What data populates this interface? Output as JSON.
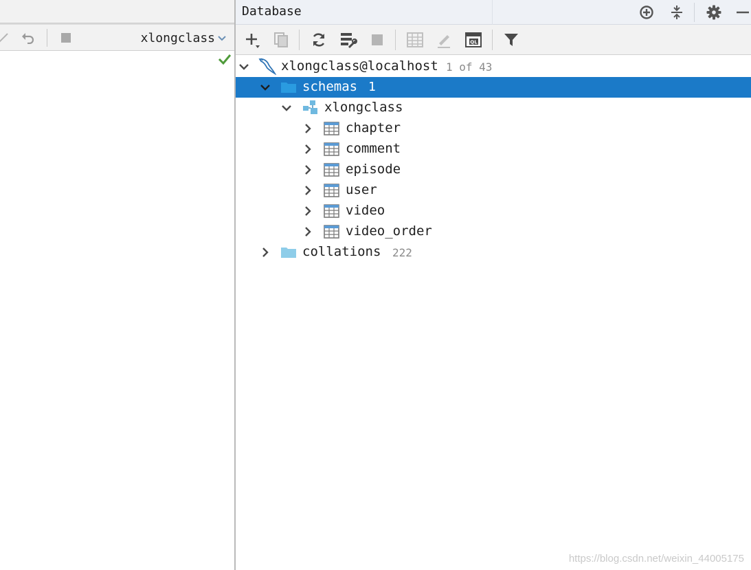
{
  "editor": {
    "schema_selector": "xlongclass",
    "status_icon": "check-icon"
  },
  "panel": {
    "title": "Database",
    "header_icons": [
      "crosshair-icon",
      "collapse-icon",
      "gear-icon",
      "minimize-icon"
    ]
  },
  "toolbar": {
    "icons": [
      "add-icon",
      "copy-icon",
      "refresh-icon",
      "schema-tools-icon",
      "stop-icon",
      "table-icon",
      "edit-icon",
      "sql-console-icon",
      "filter-icon"
    ]
  },
  "tree": {
    "connection": {
      "label": "xlongclass@localhost",
      "count": "1 of 43"
    },
    "schemas": {
      "label": "schemas",
      "count": "1"
    },
    "schema": {
      "label": "xlongclass"
    },
    "tables": [
      {
        "label": "chapter"
      },
      {
        "label": "comment"
      },
      {
        "label": "episode"
      },
      {
        "label": "user"
      },
      {
        "label": "video"
      },
      {
        "label": "video_order"
      }
    ],
    "collations": {
      "label": "collations",
      "count": "222"
    }
  },
  "watermark": "https://blog.csdn.net/weixin_44005175",
  "colors": {
    "selection": "#1b7ac8",
    "folder": "#8ecde9",
    "table_icon": "#5b9bd5",
    "ok": "#4f9b3a"
  }
}
